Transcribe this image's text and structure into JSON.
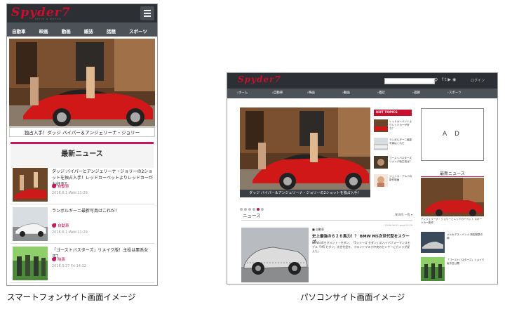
{
  "smartphone": {
    "logo": "Spyder7",
    "tagline": "STYLE & MOTOR",
    "nav": [
      "自動車",
      "映画",
      "動画",
      "雑誌",
      "話題",
      "スポーツ"
    ],
    "hero_caption": "独占入手！ダッジ バイパー＆アンジェリーナ・ジョリー",
    "news_heading": "最新ニュース",
    "items": [
      {
        "title": "ダッジ バイパーとアンジェリーナ・ジョリーの2ショットを独占入手！レッドカーペットよりレッドカーがお好き？",
        "tag": "自動車",
        "date": "2016.6.1 Wed 11:29"
      },
      {
        "title": "ランボルギーニ最新写真はこれだ！",
        "tag": "自動車",
        "date": "2016.6.1 Wed 11:29"
      },
      {
        "title": "「ゴーストバスターズ」リメイク版！主役は悪系女子？",
        "tag": "映画",
        "date": "2016.5.27 Fri 14:32"
      }
    ]
  },
  "pc": {
    "logo": "Spyder7",
    "login": "ログイン",
    "nav": [
      "ホーム",
      "自動車",
      "映画",
      "動画",
      "雑誌",
      "話題",
      "スポーツ"
    ],
    "hero_caption": "ダッジ バイパー＆アンジェリーナ・ジョリーの2ショットを独占入手！",
    "hot_topics_label": "HOT TOPICS",
    "hot_topics": [
      "レッドカーペットよりレッドカーが好き？",
      "ランボルギーニ最新写真はこれだ",
      "ゴーストバスターズ リメイク版主役は？",
      "ジェシカ・アルバの新作映画"
    ],
    "ad_label": "A D",
    "side_news_label": "最新ニュース",
    "side_news": [
      {
        "title": "アンジェリーナ・ジョリーとレッドカーペット スポーツカー新作"
      },
      {
        "title": "メルセデス・ベンツ 新型発表の噂"
      },
      {
        "title": "「ゴーストバスターズ」リメイク版予告公開"
      }
    ],
    "section_title": "ニュース",
    "section_more": "NEWS 一覧",
    "section_sub": "2016.06.01 wed 11:29",
    "article": {
      "tag": "自動車",
      "title": "史上最強の６２６馬力！？ BMW M5次世代型をスクープ",
      "body": "BMWのEセグメント・セダン、「5シリーズ セダン」のハイパフォーマンスモデル「M5 セダン」次世代型を、フロントマスク中央のセンサーにカメラが捉えた。"
    }
  },
  "captions": {
    "smartphone": "スマートフォンサイト画面イメージ",
    "pc": "パソコンサイト画面イメージ"
  }
}
